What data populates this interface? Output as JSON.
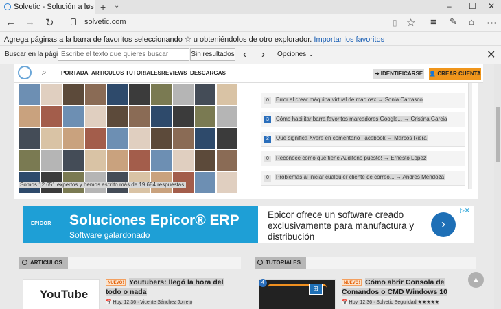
{
  "browser": {
    "tab_title": "Solvetic - Solución a los",
    "url": "solvetic.com"
  },
  "favbar": {
    "message": "Agrega páginas a la barra de favoritos seleccionando ☆ u obteniéndolos de otro explorador.",
    "import_link": "Importar los favoritos"
  },
  "findbar": {
    "label": "Buscar en la página",
    "placeholder": "Escribe el texto que quieres buscar",
    "status": "Sin resultados",
    "options": "Opciones"
  },
  "site": {
    "nav": [
      "PORTADA",
      "ARTICULOS",
      "TUTORIALES",
      "REVIEWS",
      "DESCARGAS"
    ],
    "login": "IDENTIFICARSE",
    "signup": "CREAR CUENTA",
    "members_text": "Somos 12.651 expertos y hemos escrito más de 19.684 respuestas.",
    "questions": [
      {
        "count": "0",
        "text": "Error al crear máquina virtual de mac osx → Sonia Carrasco",
        "highlight": false
      },
      {
        "count": "3",
        "text": "Cómo habilitar barra favoritos marcadores Google... → Cristina Garcia",
        "highlight": true
      },
      {
        "count": "2",
        "text": "Qué significa Xvere en comentario Facebook → Marcos Riera",
        "highlight": true
      },
      {
        "count": "0",
        "text": "Reconoce como que tiene Audifono puesto! → Ernesto Lopez",
        "highlight": false
      },
      {
        "count": "0",
        "text": "Problemas al iniciar cualquier cliente de correo... → Andres Mendoza",
        "highlight": false
      }
    ],
    "ad": {
      "logo": "EPICOR",
      "title": "Soluciones Epicor® ERP",
      "subtitle": "Software galardonado",
      "text": "Epicor ofrece un software creado exclusivamente para manufactura y distribución"
    },
    "articles": {
      "header": "ARTICULOS",
      "badge": "NUEVO!",
      "title": "Youtubers: llegó la hora del todo o nada",
      "meta": "Hoy, 12:36  ·  Vicente Sánchez Jorreto",
      "thumb": "YouTube"
    },
    "tutorials": {
      "header": "TUTORIALES",
      "badge": "NUEVO!",
      "title": "Cómo abrir Consola de Comandos o CMD Windows 10",
      "meta": "Hoy, 12:36  ·  Solvetic Seguridad ★★★★★",
      "count": "4"
    }
  }
}
